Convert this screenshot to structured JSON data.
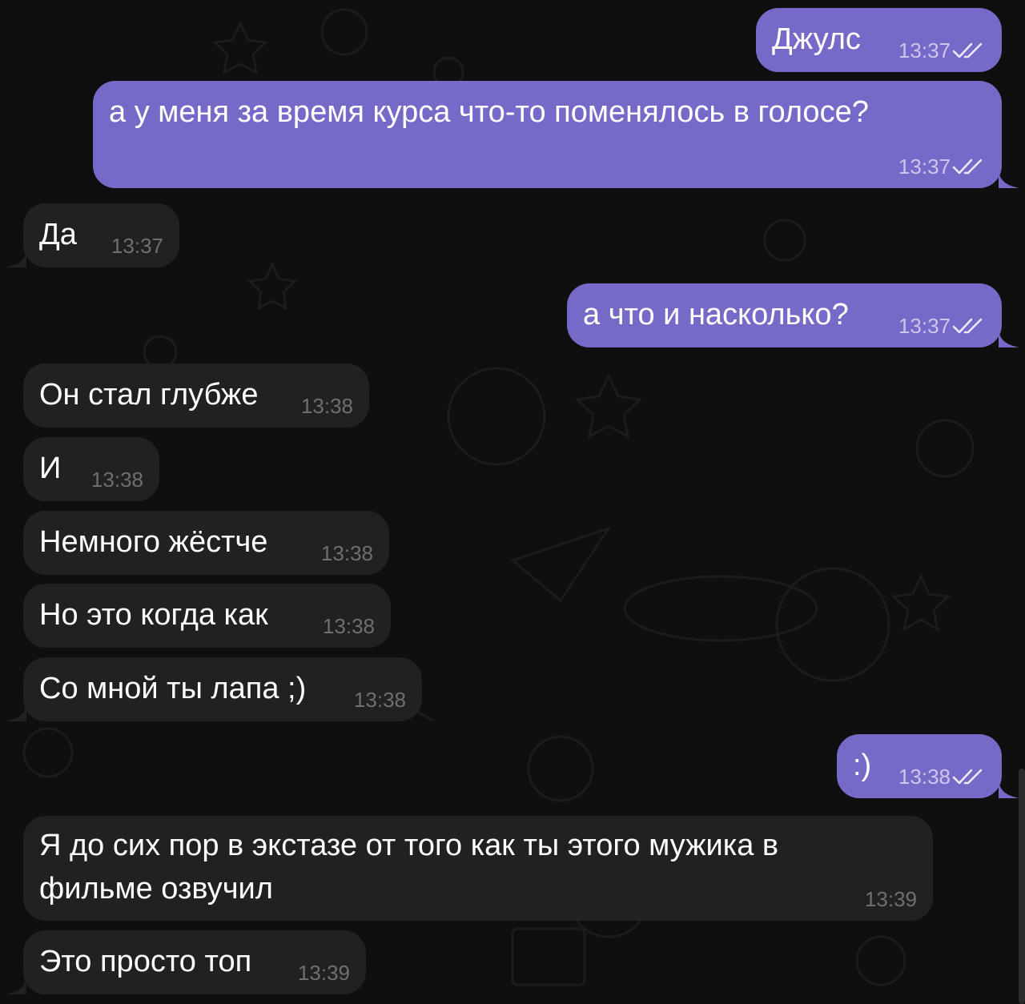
{
  "theme": {
    "outgoing_bubble": "#766ac8",
    "incoming_bubble": "#212121",
    "background": "#0f0f0f"
  },
  "messages": [
    {
      "text": "Джулс",
      "time": "13:37",
      "out": true,
      "read": true
    },
    {
      "text": "а у меня за время курса что-то поменялось в голосе?",
      "time": "13:37",
      "out": true,
      "read": true
    },
    {
      "text": "Да",
      "time": "13:37",
      "out": false
    },
    {
      "text": "а что и насколько?",
      "time": "13:37",
      "out": true,
      "read": true
    },
    {
      "text": "Он стал глубже",
      "time": "13:38",
      "out": false
    },
    {
      "text": "И",
      "time": "13:38",
      "out": false
    },
    {
      "text": "Немного жёстче",
      "time": "13:38",
      "out": false
    },
    {
      "text": "Но это когда как",
      "time": "13:38",
      "out": false
    },
    {
      "text": "Со мной ты лапа ;)",
      "time": "13:38",
      "out": false
    },
    {
      "text": ":)",
      "time": "13:38",
      "out": true,
      "read": true
    },
    {
      "text": "Я до сих пор в экстазе от того как ты этого мужика в\nфильме озвучил",
      "time": "13:39",
      "out": false
    },
    {
      "text": "Это просто топ",
      "time": "13:39",
      "out": false
    }
  ]
}
